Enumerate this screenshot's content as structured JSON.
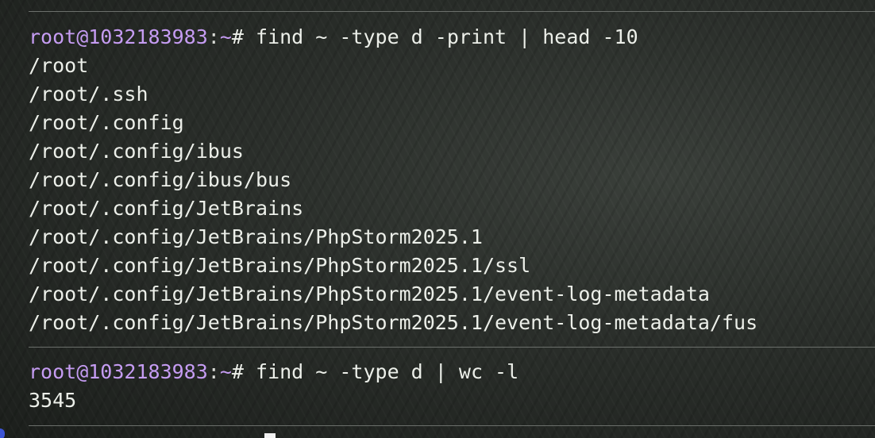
{
  "session1": {
    "prompt": {
      "user_host": "root@1032183983",
      "separator": ":",
      "path": "~",
      "symbol": "#",
      "command": " find ~ -type d -print | head -10"
    },
    "output": [
      "/root",
      "/root/.ssh",
      "/root/.config",
      "/root/.config/ibus",
      "/root/.config/ibus/bus",
      "/root/.config/JetBrains",
      "/root/.config/JetBrains/PhpStorm2025.1",
      "/root/.config/JetBrains/PhpStorm2025.1/ssl",
      "/root/.config/JetBrains/PhpStorm2025.1/event-log-metadata",
      "/root/.config/JetBrains/PhpStorm2025.1/event-log-metadata/fus"
    ]
  },
  "session2": {
    "prompt": {
      "user_host": "root@1032183983",
      "separator": ":",
      "path": "~",
      "symbol": "#",
      "command": " find ~ -type d | wc -l"
    },
    "output": [
      "3545"
    ]
  },
  "colors": {
    "prompt_user": "#c59cf2",
    "text": "#ecefe9",
    "divider": "#6b6f6b"
  }
}
